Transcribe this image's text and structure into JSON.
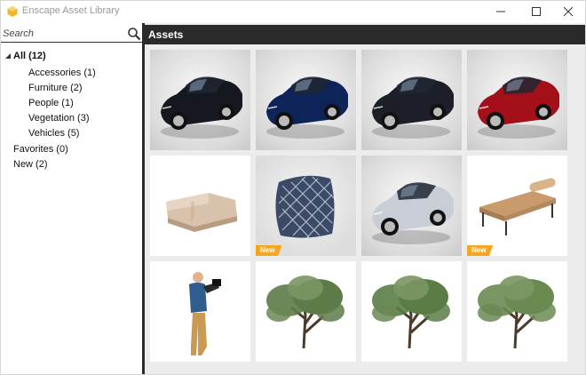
{
  "window": {
    "title": "Enscape Asset Library",
    "controls": {
      "minimize": "minimize",
      "maximize": "maximize",
      "close": "close"
    }
  },
  "search": {
    "placeholder": "Search",
    "value": ""
  },
  "tree": [
    {
      "label": "All (12)",
      "bold": true,
      "expanded": true,
      "level": 0
    },
    {
      "label": "Accessories (1)",
      "level": 1
    },
    {
      "label": "Furniture (2)",
      "level": 1
    },
    {
      "label": "People (1)",
      "level": 1
    },
    {
      "label": "Vegetation (3)",
      "level": 1
    },
    {
      "label": "Vehicles (5)",
      "level": 1
    },
    {
      "label": "Favorites (0)",
      "level": 0
    },
    {
      "label": "New (2)",
      "level": 0
    }
  ],
  "assets": {
    "header": "Assets",
    "new_badge": "New",
    "items": [
      {
        "name": "car-black",
        "kind": "car",
        "color": "#15181f",
        "new": false
      },
      {
        "name": "car-blue",
        "kind": "car",
        "color": "#0e2357",
        "new": false
      },
      {
        "name": "car-dark-gray",
        "kind": "car",
        "color": "#1c1f28",
        "new": false
      },
      {
        "name": "car-red",
        "kind": "car",
        "color": "#a3101a",
        "new": false
      },
      {
        "name": "sofa",
        "kind": "sofa",
        "color": "#d8c2ab",
        "new": false
      },
      {
        "name": "cushion",
        "kind": "cushion",
        "color": "#3b4a66",
        "new": true
      },
      {
        "name": "car-silver",
        "kind": "car",
        "color": "#c9ced6",
        "new": false
      },
      {
        "name": "daybed",
        "kind": "daybed",
        "color": "#c99a6c",
        "new": true
      },
      {
        "name": "person-photographer",
        "kind": "person",
        "color": "#2f5e8e",
        "new": false
      },
      {
        "name": "tree-1",
        "kind": "tree",
        "color": "#5d7a49",
        "new": false
      },
      {
        "name": "tree-2",
        "kind": "tree",
        "color": "#5a7d46",
        "new": false
      },
      {
        "name": "tree-3",
        "kind": "tree",
        "color": "#6a8a52",
        "new": false
      }
    ]
  }
}
